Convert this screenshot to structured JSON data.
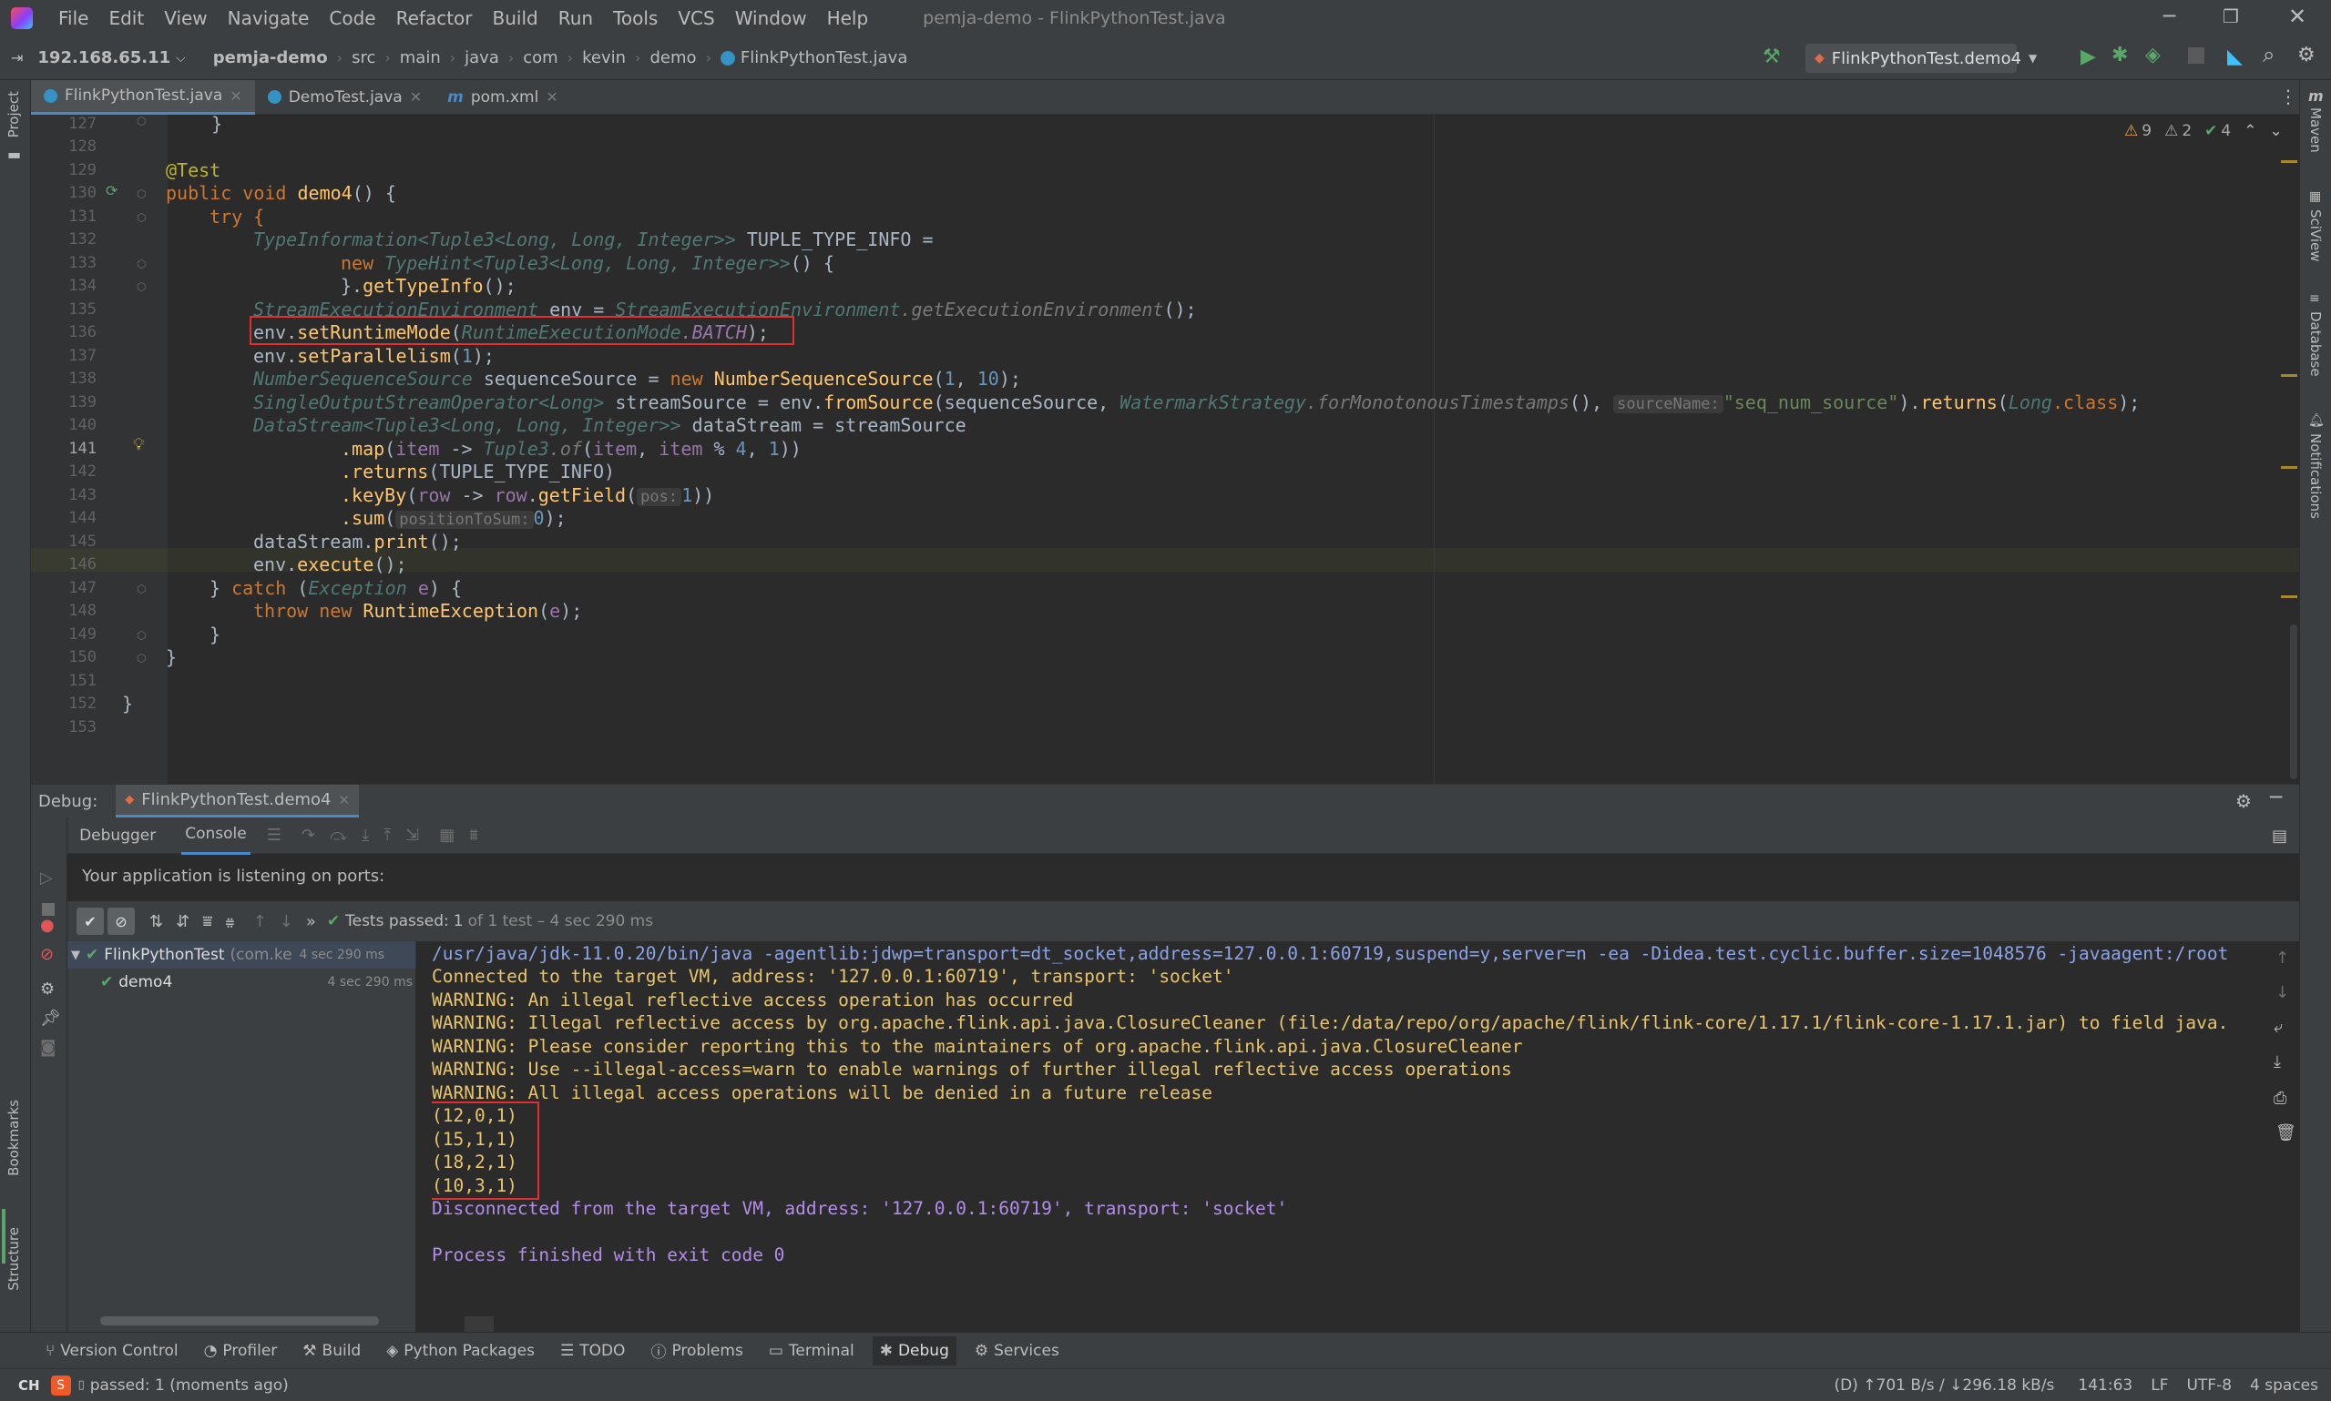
{
  "title_bar": {
    "menus": [
      "File",
      "Edit",
      "View",
      "Navigate",
      "Code",
      "Refactor",
      "Build",
      "Run",
      "Tools",
      "VCS",
      "Window",
      "Help"
    ],
    "title": "pemja-demo - FlinkPythonTest.java"
  },
  "nav_bar": {
    "host": "192.168.65.11",
    "breadcrumbs": [
      "pemja-demo",
      "src",
      "main",
      "java",
      "com",
      "kevin",
      "demo",
      "FlinkPythonTest.java"
    ],
    "run_config": "FlinkPythonTest.demo4"
  },
  "tabs": [
    {
      "label": "FlinkPythonTest.java",
      "active": true
    },
    {
      "label": "DemoTest.java",
      "active": false
    },
    {
      "label": "pom.xml",
      "active": false
    }
  ],
  "inspections": {
    "warnings": "9",
    "weak": "2",
    "ok": "4"
  },
  "line_numbers": [
    "127",
    "128",
    "129",
    "130",
    "131",
    "132",
    "133",
    "134",
    "135",
    "136",
    "137",
    "138",
    "139",
    "140",
    "141",
    "142",
    "143",
    "144",
    "145",
    "146",
    "147",
    "148",
    "149",
    "150",
    "151",
    "152",
    "153"
  ],
  "code": {
    "l127": "    }",
    "l129_ann": "@Test",
    "l130_a": "public void ",
    "l130_fn": "demo4",
    "l130_b": "() {",
    "l131": "try {",
    "l132_ty": "TypeInformation<Tuple3<Long, Long, Integer>>",
    "l132_b": " TUPLE_TYPE_INFO =",
    "l133_kw": "new ",
    "l133_ty": "TypeHint<Tuple3<Long, Long, Integer>>",
    "l133_b": "() {",
    "l134_a": "}.",
    "l134_fn": "getTypeInfo",
    "l134_b": "();",
    "l135_ty": "StreamExecutionEnvironment",
    "l135_b": " env = ",
    "l135_ty2": "StreamExecutionEnvironment",
    "l135_g": ".getExecutionEnvironment",
    "l135_c": "();",
    "l136_a": "env.",
    "l136_fn": "setRuntimeMode",
    "l136_b": "(",
    "l136_ty": "RuntimeExecutionMode",
    "l136_par": ".BATCH",
    "l136_c": ");",
    "l137_a": "env.",
    "l137_fn": "setParallelism",
    "l137_b": "(",
    "l137_num": "1",
    "l137_c": ");",
    "l138_ty": "NumberSequenceSource",
    "l138_b": " sequenceSource = ",
    "l138_kw": "new ",
    "l138_fn": "NumberSequenceSource",
    "l138_c": "(",
    "l138_n1": "1",
    "l138_d": ", ",
    "l138_n2": "10",
    "l138_e": ");",
    "l139_ty": "SingleOutputStreamOperator<Long>",
    "l139_b": " streamSource = env.",
    "l139_fn": "fromSource",
    "l139_c": "(sequenceSource, ",
    "l139_ty2": "WatermarkStrategy",
    "l139_g": ".forMonotonousTimestamps",
    "l139_d": "(), ",
    "l139_hint": "sourceName:",
    "l139_str": "\"seq_num_source\"",
    "l139_e": ").",
    "l139_fn2": "returns",
    "l139_f": "(",
    "l139_ty3": "Long",
    "l139_g2": ".class",
    "l139_h": ");",
    "l140_ty": "DataStream<Tuple3<Long, Long, Integer>>",
    "l140_b": " dataStream = streamSource",
    "l141_a": ".map",
    "l141_b": "(",
    "l141_p": "item",
    "l141_c": " -> ",
    "l141_ty": "Tuple3",
    "l141_g": ".of",
    "l141_d": "(",
    "l141_p2": "item",
    ", ": ", ",
    "l141_p3": "item",
    "l141_e": " % ",
    "l141_n1": "4",
    "l141_f": ", ",
    "l141_n2": "1",
    "l141_h": "))",
    "l142_a": ".returns",
    "l142_b": "(TUPLE_TYPE_INFO)",
    "l143_a": ".keyBy",
    "l143_b": "(",
    "l143_p": "row",
    "l143_c": " -> ",
    "l143_p2": "row",
    "l143_d": ".",
    "l143_fn": "getField",
    "l143_e": "(",
    "l143_hint": "pos:",
    "l143_n": "1",
    "l143_f": "))",
    "l144_a": ".sum",
    "l144_b": "(",
    "l144_hint": "positionToSum:",
    "l144_n": "0",
    "l144_c": ");",
    "l145_a": "dataStream.",
    "l145_fn": "print",
    "l145_b": "();",
    "l146_a": "env.",
    "l146_fn": "execute",
    "l146_b": "();",
    "l147_a": "} ",
    "l147_kw": "catch ",
    "l147_b": "(",
    "l147_ty": "Exception ",
    "l147_p": "e",
    "l147_c": ") {",
    "l148_kw": "throw new ",
    "l148_fn": "RuntimeException",
    "l148_b": "(",
    "l148_p": "e",
    "l148_c": ");",
    "l149": "}",
    "l150": "}",
    "l152": "}"
  },
  "debug": {
    "label": "Debug:",
    "session": "FlinkPythonTest.demo4",
    "tabs": [
      "Debugger",
      "Console"
    ],
    "listening": "Your application is listening on ports:",
    "tests_passed": "Tests passed:",
    "tests_count": "1",
    "tests_rest": "of 1 test – 4 sec 290 ms",
    "tree": [
      {
        "label": "FlinkPythonTest",
        "sub": "(com.ke",
        "time": "4 sec 290 ms"
      },
      {
        "label": "demo4",
        "sub": "",
        "time": "4 sec 290 ms"
      }
    ]
  },
  "console": {
    "cmd": "/usr/java/jdk-11.0.20/bin/java -agentlib:jdwp=transport=dt_socket,address=127.0.0.1:60719,suspend=y,server=n -ea -Didea.test.cyclic.buffer.size=1048576 -javaagent:/root",
    "connected": "Connected to the target VM, address: '127.0.0.1:60719', transport: 'socket'",
    "warn1": "WARNING: An illegal reflective access operation has occurred",
    "warn2": "WARNING: Illegal reflective access by org.apache.flink.api.java.ClosureCleaner (file:/data/repo/org/apache/flink/flink-core/1.17.1/flink-core-1.17.1.jar) to field java.",
    "warn3": "WARNING: Please consider reporting this to the maintainers of org.apache.flink.api.java.ClosureCleaner",
    "warn4": "WARNING: Use --illegal-access=warn to enable warnings of further illegal reflective access operations",
    "warn5": "WARNING: All illegal access operations will be denied in a future release",
    "results": [
      "(12,0,1)",
      "(15,1,1)",
      "(18,2,1)",
      "(10,3,1)"
    ],
    "disconnected": "Disconnected from the target VM, address: '127.0.0.1:60719', transport: 'socket'",
    "finished": "Process finished with exit code 0"
  },
  "left_labels": [
    "Project",
    "Bookmarks",
    "Structure"
  ],
  "right_labels": [
    "Maven",
    "SciView",
    "Database",
    "Notifications"
  ],
  "bottom_tools": [
    "Version Control",
    "Profiler",
    "Build",
    "Python Packages",
    "TODO",
    "Problems",
    "Terminal",
    "Debug",
    "Services"
  ],
  "status": {
    "left": "passed: 1 (moments ago)",
    "ime": "CH",
    "net": "(D) ↑701 B/s / ↓296.18 kB/s",
    "pos": "141:63",
    "lf": "LF",
    "enc": "UTF-8",
    "indent": "4 spaces"
  }
}
